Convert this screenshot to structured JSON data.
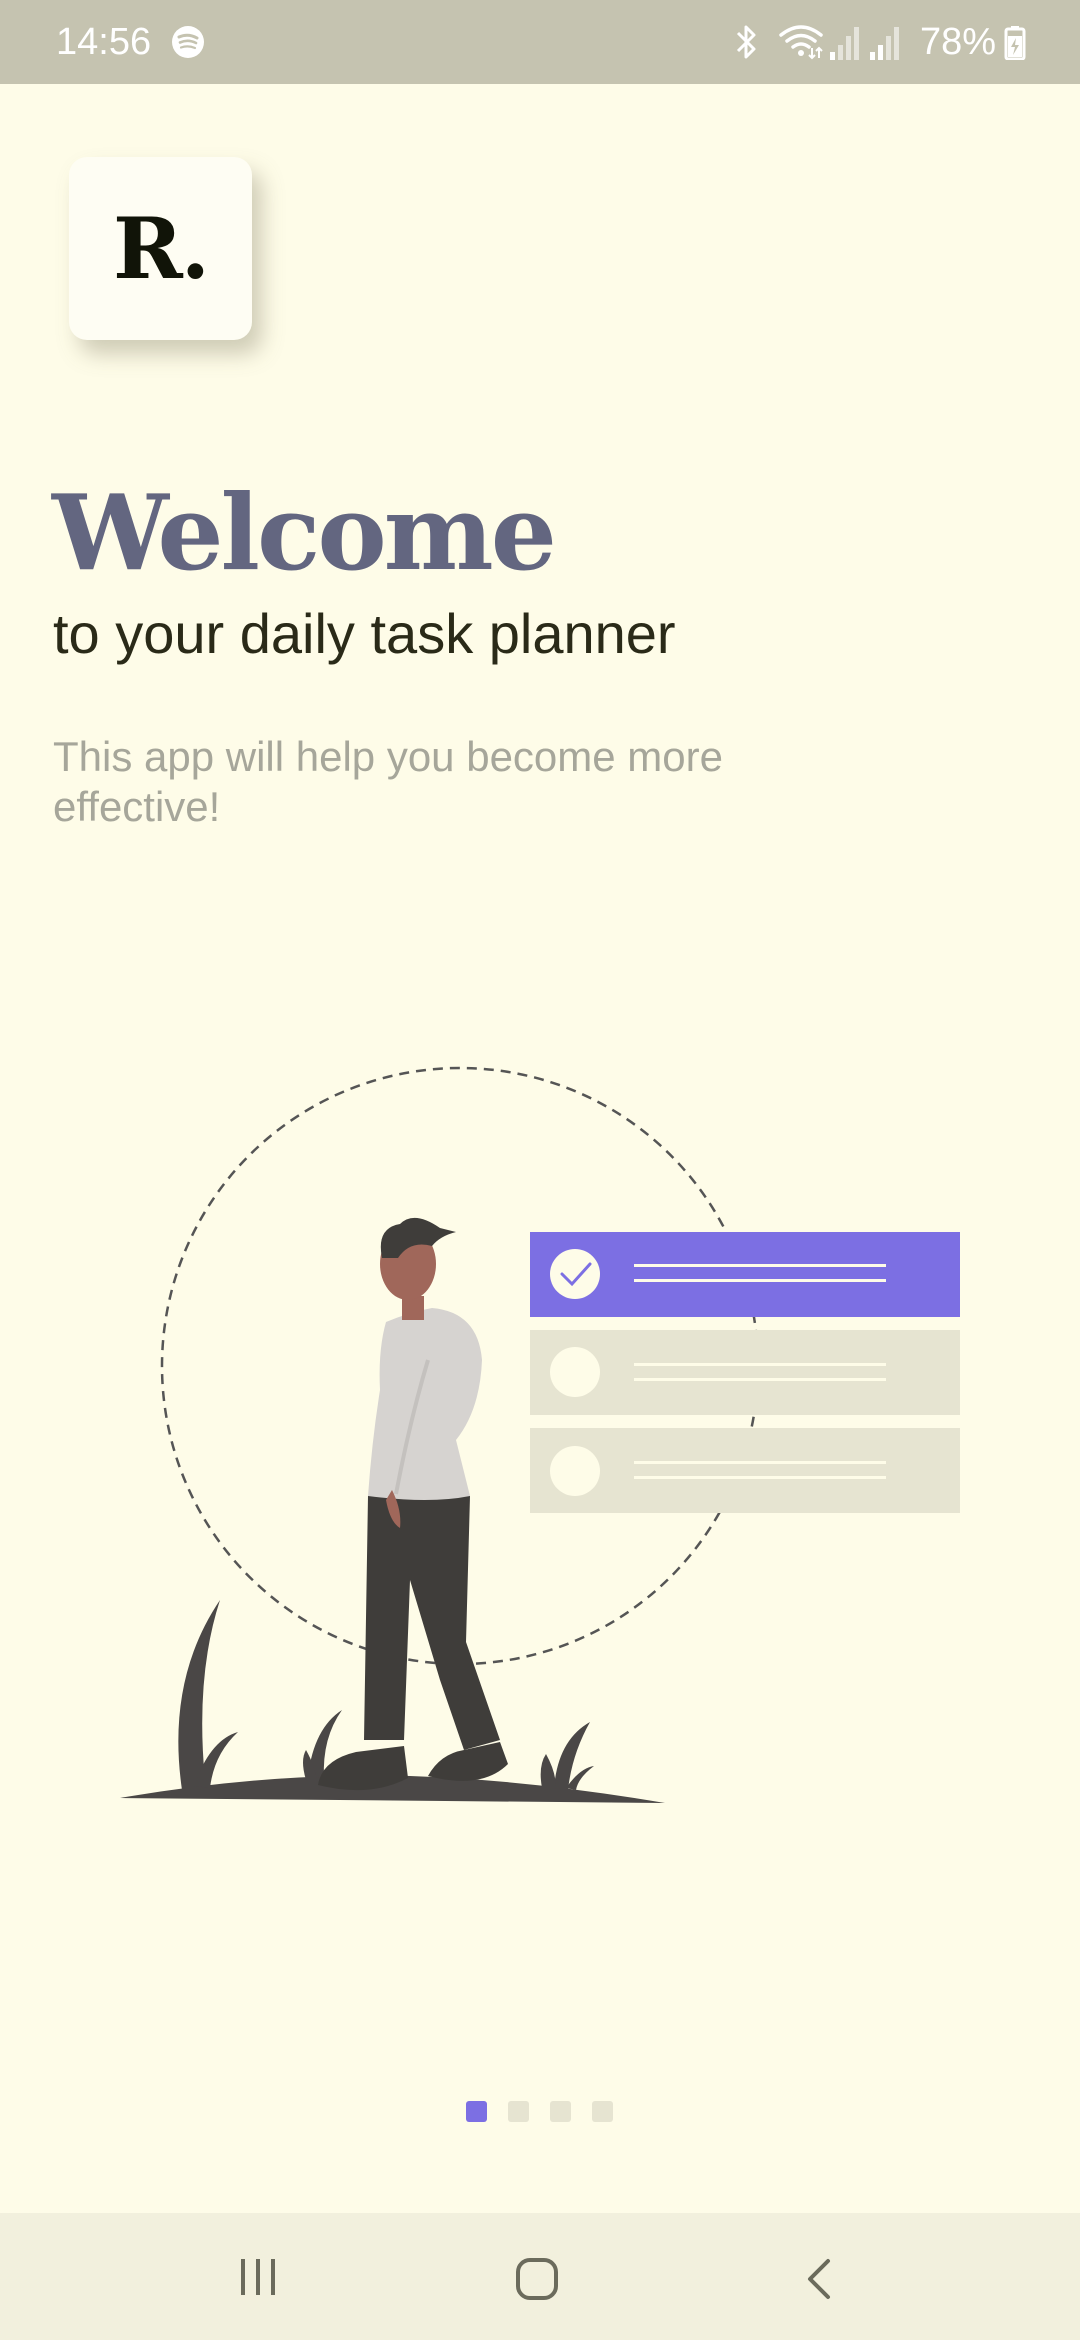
{
  "status_bar": {
    "time": "14:56",
    "battery": "78%",
    "icons": [
      "spotify-icon",
      "bluetooth-icon",
      "wifi-icon",
      "signal-icon",
      "signal-icon",
      "battery-charging-icon"
    ]
  },
  "logo": {
    "text": "R."
  },
  "onboarding": {
    "title": "Welcome",
    "subtitle": "to your daily task planner",
    "description": "This app will help you become more effective!"
  },
  "illustration": {
    "tasks": [
      {
        "checked": true
      },
      {
        "checked": false
      },
      {
        "checked": false
      }
    ]
  },
  "pagination": {
    "current_page": 1,
    "total_pages": 4
  },
  "colors": {
    "background": "#fefce8",
    "accent": "#7c6fe3",
    "title": "#636680",
    "status_bar": "#c5c3b0",
    "nav_bar": "#f2f0dd"
  },
  "nav_bar": {
    "icons": [
      "recents-icon",
      "home-icon",
      "back-icon"
    ]
  }
}
